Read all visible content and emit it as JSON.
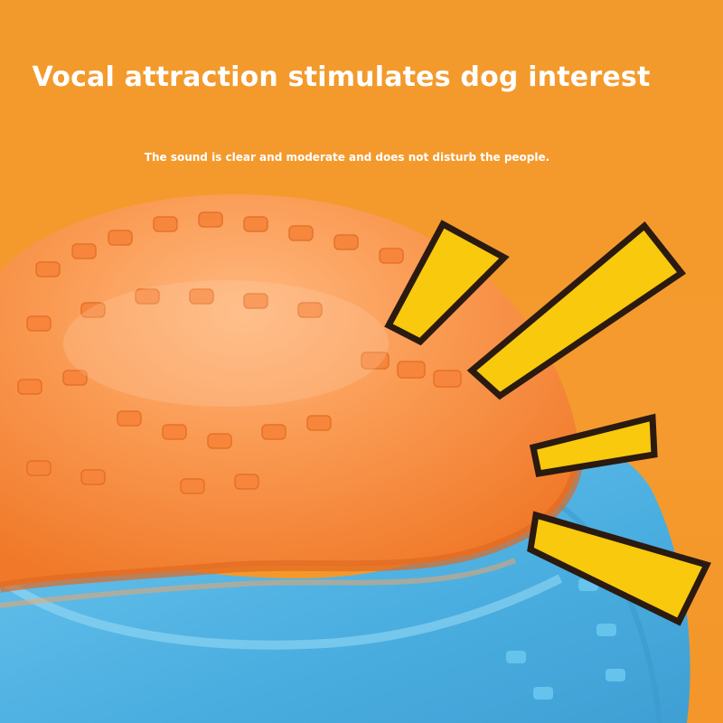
{
  "headline": "Vocal attraction stimulates dog interest",
  "subline": "The sound is clear and moderate and does not disturb the people.",
  "colors": {
    "background": "#f39a2c",
    "ball_orange": "#f7893a",
    "ball_blue": "#4fb3e4",
    "burst_fill": "#f8c90c",
    "burst_outline": "#2a1a10"
  },
  "illustration": {
    "subject": "orange-and-blue-ball",
    "burst_lines": 4
  }
}
